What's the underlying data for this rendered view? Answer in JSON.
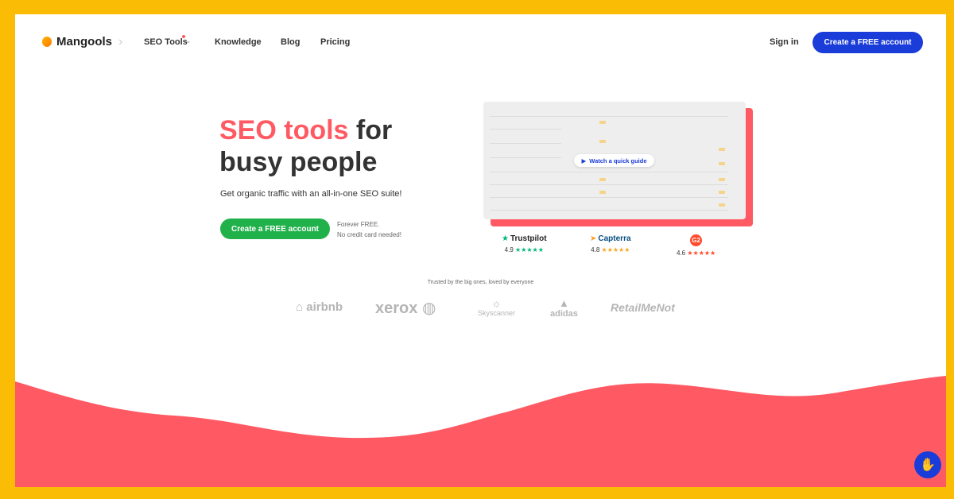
{
  "nav": {
    "logo": "Mangools",
    "items": [
      "SEO Tools",
      "Knowledge",
      "Blog",
      "Pricing"
    ],
    "signin": "Sign in",
    "cta": "Create a FREE account"
  },
  "hero": {
    "title_red": "SEO tools",
    "title_rest1": " for",
    "title_line2": "busy people",
    "subtitle": "Get organic traffic with an all-in-one SEO suite!",
    "cta": "Create a FREE account",
    "forever": "Forever FREE.",
    "no_card": "No credit card needed!"
  },
  "video": {
    "watch_label": "Watch a quick guide"
  },
  "ratings": [
    {
      "name": "Trustpilot",
      "score": "4.9"
    },
    {
      "name": "Capterra",
      "score": "4.8"
    },
    {
      "name": "G2",
      "score": "4.6"
    }
  ],
  "trusted": {
    "text": "Trusted by the big ones, loved by everyone",
    "brands": [
      "airbnb",
      "xerox",
      "Skyscanner",
      "adidas",
      "RetailMeNot"
    ]
  },
  "colors": {
    "accent_blue": "#1a3cd8",
    "accent_red": "#ff5a63",
    "cta_green": "#21b14b",
    "frame_yellow": "#fbbc05"
  }
}
